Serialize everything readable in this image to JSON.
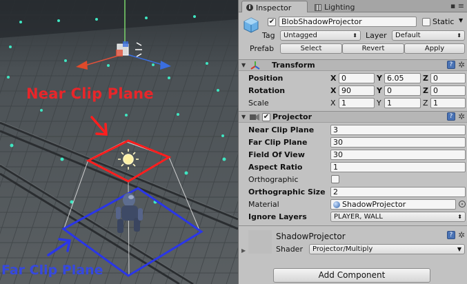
{
  "scene": {
    "near_label": "Near Clip Plane",
    "far_label": "Far Clip Plane"
  },
  "tabs": [
    {
      "label": "Inspector",
      "icon": "info-icon",
      "active": true
    },
    {
      "label": "Lighting",
      "icon": "lighting-icon",
      "active": false
    }
  ],
  "object": {
    "enabled": true,
    "name": "BlobShadowProjector",
    "static_label": "Static",
    "static_checked": false,
    "tag_label": "Tag",
    "tag_value": "Untagged",
    "layer_label": "Layer",
    "layer_value": "Default",
    "prefab_label": "Prefab",
    "prefab_buttons": [
      "Select",
      "Revert",
      "Apply"
    ]
  },
  "transform": {
    "title": "Transform",
    "rows": [
      {
        "label": "Position",
        "bold": true,
        "x": "0",
        "y": "6.05",
        "z": "0"
      },
      {
        "label": "Rotation",
        "bold": true,
        "x": "90",
        "y": "0",
        "z": "0"
      },
      {
        "label": "Scale",
        "bold": false,
        "x": "1",
        "y": "1",
        "z": "1"
      }
    ]
  },
  "projector": {
    "title": "Projector",
    "enabled": true,
    "near_clip_label": "Near Clip Plane",
    "near_clip": "3",
    "far_clip_label": "Far Clip Plane",
    "far_clip": "30",
    "fov_label": "Field Of View",
    "fov": "30",
    "aspect_label": "Aspect Ratio",
    "aspect": "1",
    "ortho_label": "Orthographic",
    "ortho_checked": false,
    "ortho_size_label": "Orthographic Size",
    "ortho_size": "2",
    "material_label": "Material",
    "material": "ShadowProjector",
    "ignore_label": "Ignore Layers",
    "ignore_layers": "PLAYER, WALL"
  },
  "material_section": {
    "name": "ShadowProjector",
    "shader_label": "Shader",
    "shader_value": "Projector/Multiply"
  },
  "add_component_label": "Add Component",
  "colors": {
    "near_annotation": "#e8262a",
    "far_annotation": "#3548e0",
    "inspector_bg": "#c2c2c2"
  }
}
